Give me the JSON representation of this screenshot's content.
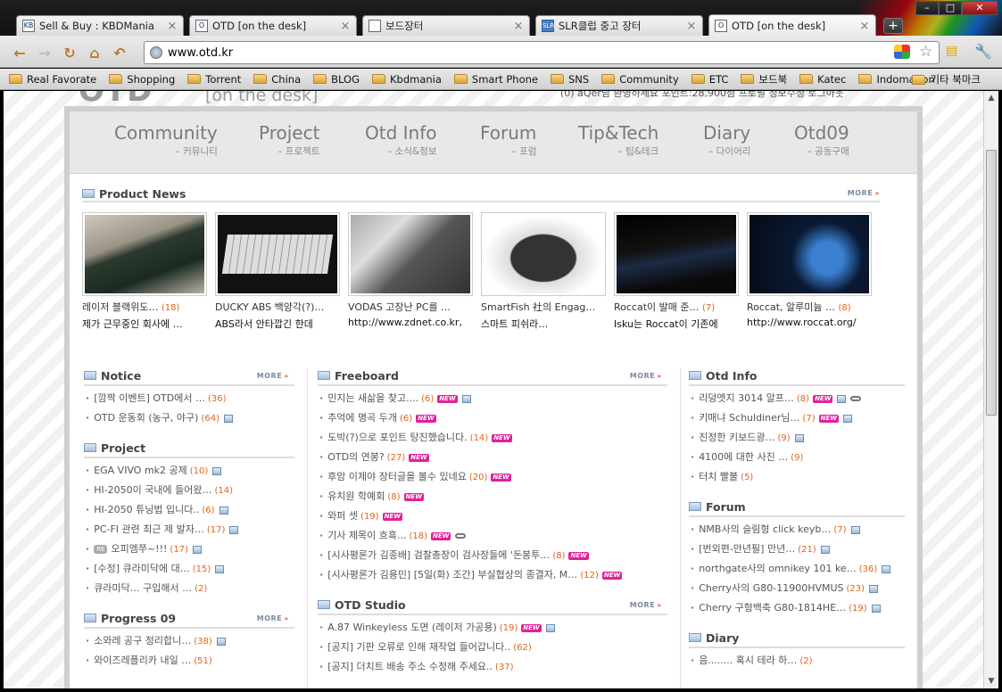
{
  "window": {
    "tabs": [
      {
        "title": "Sell & Buy : KBDMania",
        "favicon": "KB",
        "active": false
      },
      {
        "title": "OTD [on the desk]",
        "favicon": "O",
        "active": false
      },
      {
        "title": "보드장터",
        "favicon": "",
        "active": false
      },
      {
        "title": "SLR클럽 중고 장터",
        "favicon": "SLR",
        "active": false
      },
      {
        "title": "OTD [on the desk]",
        "favicon": "O",
        "active": true
      }
    ],
    "new_tab": "+",
    "minimize": "–",
    "maximize": "□",
    "close": "✕"
  },
  "toolbar": {
    "back": "←",
    "forward": "→",
    "reload": "↻",
    "home": "⌂",
    "undo": "↶",
    "url": "www.otd.kr"
  },
  "bookmarks": [
    "Real Favorate",
    "Shopping",
    "Torrent",
    "China",
    "BLOG",
    "Kbdmania",
    "Smart Phone",
    "SNS",
    "Community",
    "ETC",
    "보드북",
    "Katec",
    "Indomation"
  ],
  "other_bookmarks": "기타 북마크",
  "page_top": {
    "logo": "OTD",
    "logo_sub": "[on the desk]",
    "login_text": "(0) aQer님 환영하세요    포인트:28,900점    프로필    정보수정   로그아웃"
  },
  "menu": [
    {
      "en": "Community",
      "ko": "– 커뮤니티"
    },
    {
      "en": "Project",
      "ko": "– 프로젝트"
    },
    {
      "en": "Otd Info",
      "ko": "– 소식&정보"
    },
    {
      "en": "Forum",
      "ko": "– 포럼"
    },
    {
      "en": "Tip&Tech",
      "ko": "– 팁&테크"
    },
    {
      "en": "Diary",
      "ko": "– 다이어리"
    },
    {
      "en": "Otd09",
      "ko": "– 공동구매"
    }
  ],
  "product_news": {
    "title": "Product News",
    "more": "MORE",
    "items": [
      {
        "title": "레이저 블랙위도…",
        "count": "(18)",
        "desc": "제가 근무중인 회사에 …"
      },
      {
        "title": "DUCKY ABS 백양각(?)…",
        "count": "",
        "desc": "ABS라서 안타깝긴 한데"
      },
      {
        "title": "VODAS 고장난 PC를 …",
        "count": "",
        "desc": "http://www.zdnet.co.kr,"
      },
      {
        "title": "SmartFish 社의 Engag…",
        "count": "",
        "desc": "  스마트 피쉬라…"
      },
      {
        "title": "Roccat이 발매 준…",
        "count": "(7)",
        "desc": "Isku는 Roccat이 기존에"
      },
      {
        "title": "Roccat, 알루미늄 …",
        "count": "(8)",
        "desc": "http://www.roccat.org/"
      }
    ]
  },
  "notice": {
    "title": "Notice",
    "more": "MORE",
    "items": [
      {
        "text": "[깜짝 이벤트] OTD에서 …",
        "count": "(36)",
        "icons": []
      },
      {
        "text": "OTD 운동회 (농구, 야구)",
        "count": "(64)",
        "icons": [
          "img"
        ]
      }
    ]
  },
  "project": {
    "title": "Project",
    "more": "",
    "items": [
      {
        "text": "EGA VIVO mk2 공제",
        "count": "(10)",
        "icons": [
          "img"
        ]
      },
      {
        "text": "HI-2050이 국내에 들어왔…",
        "count": "(14)",
        "icons": []
      },
      {
        "text": "HI-2050 튜닝법 입니다..",
        "count": "(6)",
        "icons": [
          "img"
        ]
      },
      {
        "text": "PC-FI 관련 최근 제 발자…",
        "count": "(17)",
        "icons": [
          "img"
        ]
      },
      {
        "text": "오피엠쭈~!!!",
        "count": "(17)",
        "icons": [
          "img"
        ],
        "re": "RE"
      },
      {
        "text": "[수정] 큐라미닥에 대…",
        "count": "(15)",
        "icons": [
          "img"
        ]
      },
      {
        "text": "큐라미닥… 구입해서 …",
        "count": "(2)",
        "icons": []
      }
    ]
  },
  "progress": {
    "title": "Progress 09",
    "more": "MORE",
    "items": [
      {
        "text": "소와레 공구 정리합니…",
        "count": "(38)",
        "icons": [
          "img"
        ]
      },
      {
        "text": "와이즈레플리카 내일 …",
        "count": "(51)",
        "icons": []
      }
    ]
  },
  "freeboard": {
    "title": "Freeboard",
    "more": "MORE",
    "items": [
      {
        "text": "민지는 새삶을 찾고....",
        "count": "(6)",
        "icons": [
          "new",
          "img"
        ]
      },
      {
        "text": "추억에 명곡 두개",
        "count": "(6)",
        "icons": [
          "new"
        ]
      },
      {
        "text": "도박(?)으로 포인트 탕진했습니다.",
        "count": "(14)",
        "icons": [
          "new"
        ]
      },
      {
        "text": "OTD의 연봉?",
        "count": "(27)",
        "icons": [
          "new"
        ]
      },
      {
        "text": "후암 이제야 장터글을 볼수 있네요",
        "count": "(20)",
        "icons": [
          "new"
        ]
      },
      {
        "text": "유치원 학예회",
        "count": "(8)",
        "icons": [
          "new"
        ]
      },
      {
        "text": "와퍼 셋",
        "count": "(19)",
        "icons": [
          "new"
        ]
      },
      {
        "text": "기사 제목이 흐흑...",
        "count": "(18)",
        "icons": [
          "new",
          "link"
        ]
      },
      {
        "text": "[시사평론가 김종배] 검찰총장이 검사장들에 '돈봉투…",
        "count": "(8)",
        "icons": [
          "new"
        ]
      },
      {
        "text": "[시사평론가 김용민] [5일(화) 조간] 부실협상의 종결자, M…",
        "count": "(12)",
        "icons": [
          "new"
        ]
      }
    ]
  },
  "otd_studio": {
    "title": "OTD Studio",
    "more": "MORE",
    "items": [
      {
        "text": "A.87 Winkeyless 도면 (레이저 가공용)",
        "count": "(19)",
        "icons": [
          "new",
          "img"
        ]
      },
      {
        "text": "[공지] 기판 오류로 인해 재작업 들어갑니다..",
        "count": "(62)",
        "icons": []
      },
      {
        "text": "[공지] 더치트 배송 주소 수정해 주세요..",
        "count": "(37)",
        "icons": []
      }
    ]
  },
  "otd_info": {
    "title": "Otd Info",
    "more": "",
    "items": [
      {
        "text": "리덩엣지 3014 알프…",
        "count": "(8)",
        "icons": [
          "new",
          "img",
          "link"
        ]
      },
      {
        "text": "키매냐 Schuldiner님…",
        "count": "(7)",
        "icons": [
          "new",
          "img"
        ]
      },
      {
        "text": "진정한 키보드광…",
        "count": "(9)",
        "icons": [
          "img"
        ]
      },
      {
        "text": "4100에 대한 사진 …",
        "count": "(9)",
        "icons": []
      },
      {
        "text": "터치 빨불",
        "count": "(5)",
        "icons": []
      }
    ]
  },
  "forum": {
    "title": "Forum",
    "more": "",
    "items": [
      {
        "text": "NMB사의 슬림형 click keyb…",
        "count": "(7)",
        "icons": [
          "img"
        ]
      },
      {
        "text": "[번외편-만년필] 만년…",
        "count": "(21)",
        "icons": [
          "img"
        ]
      },
      {
        "text": "northgate사의 omnikey 101 ke…",
        "count": "(36)",
        "icons": [
          "img"
        ]
      },
      {
        "text": "Cherry사의 G80-11900HVMUS",
        "count": "(23)",
        "icons": [
          "img"
        ]
      },
      {
        "text": "Cherry 구형백축 G80-1814HE…",
        "count": "(19)",
        "icons": [
          "img"
        ]
      }
    ]
  },
  "diary": {
    "title": "Diary",
    "more": "",
    "items": [
      {
        "text": "음........ 혹시 테라 하…",
        "count": "(2)",
        "icons": []
      }
    ]
  },
  "labels": {
    "new": "NEW"
  }
}
